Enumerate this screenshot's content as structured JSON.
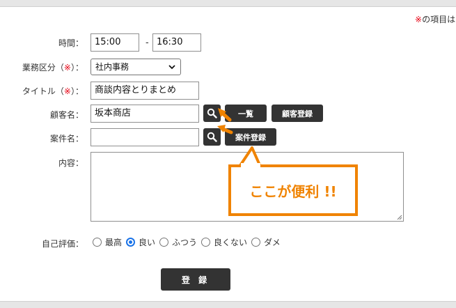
{
  "required_note": {
    "mark": "※",
    "text": "の項目は"
  },
  "form": {
    "time": {
      "label": "時間：",
      "start": "15:00",
      "separator": "-",
      "end": "16:30"
    },
    "business_category": {
      "label": "業務区分（",
      "req": "※",
      "label_end": "）：",
      "value": "社内事務"
    },
    "title": {
      "label": "タイトル（",
      "req": "※",
      "label_end": "）：",
      "value": "商談内容とりまとめ"
    },
    "customer": {
      "label": "顧客名：",
      "value": "坂本商店",
      "list_button": "一覧",
      "register_button": "顧客登録"
    },
    "project": {
      "label": "案件名：",
      "value": "",
      "register_button": "案件登録"
    },
    "content": {
      "label": "内容："
    },
    "self_rating": {
      "label": "自己評価：",
      "options": [
        "最高",
        "良い",
        "ふつう",
        "良くない",
        "ダメ"
      ],
      "selected": "良い"
    },
    "submit_label": "登 録"
  },
  "callout": {
    "text": "ここが便利 !!"
  },
  "colors": {
    "accent": "#f08300",
    "button": "#333333",
    "required": "#e60012",
    "radio": "#1a73e8"
  },
  "icons": {
    "search": "search-icon",
    "select": "chevron-down-icon",
    "resize": "resize-grip-icon"
  }
}
